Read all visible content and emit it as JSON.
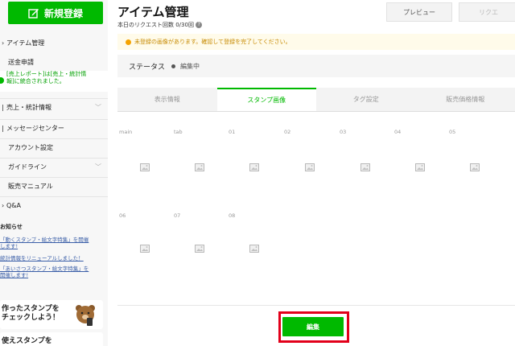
{
  "sidebar": {
    "new_button_label": "新規登録",
    "items": [
      {
        "label": "アイテム管理"
      },
      {
        "label": "送金申請"
      },
      {
        "label": "売上・統計情報"
      },
      {
        "label": "メッセージセンター"
      },
      {
        "label": "アカウント設定"
      },
      {
        "label": "ガイドライン"
      },
      {
        "label": "販売マニュアル"
      },
      {
        "label": "Q&A"
      }
    ],
    "notice_text_1": "[売上レポート]は[売上・統計情",
    "notice_text_2": "報]に統合されました。",
    "news_heading": "お知らせ",
    "news": [
      {
        "line1": "「動くスタンプ・絵文字特集」を開催",
        "line2": "します!"
      },
      {
        "line1": "統計情報をリニューアルしました！",
        "line2": ""
      },
      {
        "line1": "「あいさつスタンプ・絵文字特集」を",
        "line2": "開催します!"
      }
    ],
    "promo_1_line1": "作ったスタンプを",
    "promo_1_line2": "チェックしよう！",
    "promo_2_line1": "使えスタンプを"
  },
  "header": {
    "title": "アイテム管理",
    "request_count": "本日のリクエスト回数 0/30回",
    "preview_label": "プレビュー",
    "request_label": "リクエ"
  },
  "warning": {
    "text": "未登録の画像があります。確認して登録を完了してください。"
  },
  "status": {
    "label": "ステータス",
    "value": "編集中"
  },
  "tabs": [
    {
      "label": "表示情報"
    },
    {
      "label": "スタンプ画像"
    },
    {
      "label": "タグ設定"
    },
    {
      "label": "販売価格情報"
    }
  ],
  "stamp_grid": {
    "row1": [
      "main",
      "tab",
      "01",
      "02",
      "03",
      "04",
      "05"
    ],
    "row2": [
      "06",
      "07",
      "08"
    ]
  },
  "footer": {
    "edit_label": "編集"
  },
  "colors": {
    "accent": "#00b900",
    "highlight": "#e2001a",
    "warn": "#f5a300"
  }
}
